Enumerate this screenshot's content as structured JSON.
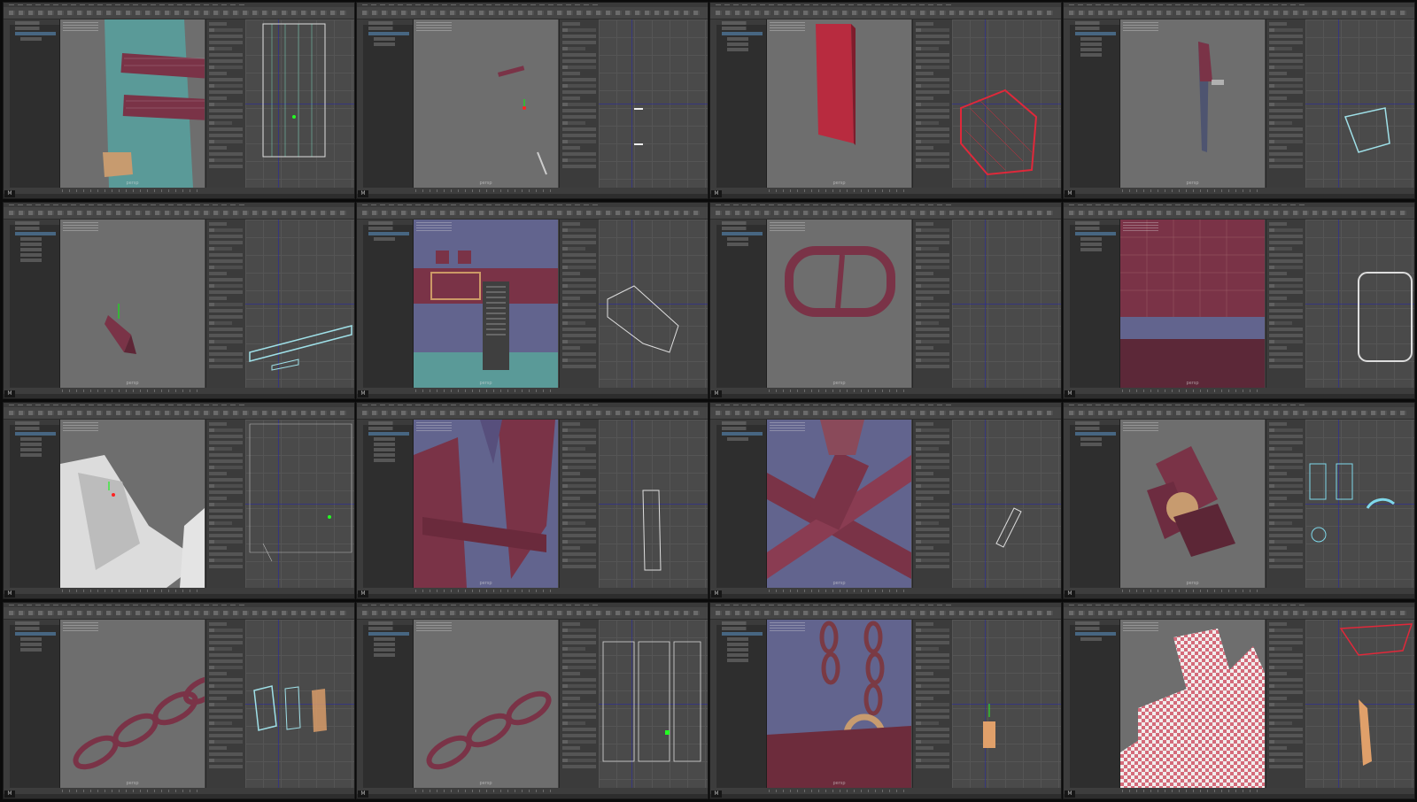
{
  "sheet": {
    "title": "",
    "tile_count": 16
  },
  "tiles": [
    {
      "id": "t1",
      "uv_color": "#d8d8d8",
      "logo": "M",
      "vp": "persp"
    },
    {
      "id": "t2",
      "uv_color": "#e8e8e8",
      "logo": "M",
      "vp": "persp"
    },
    {
      "id": "t3",
      "uv_color": "#e0283a",
      "logo": "M",
      "vp": "persp"
    },
    {
      "id": "t4",
      "uv_color": "#9fe0e8",
      "logo": "M",
      "vp": "persp"
    },
    {
      "id": "t5",
      "uv_color": "#9fe0e8",
      "logo": "M",
      "vp": "persp"
    },
    {
      "id": "t6",
      "uv_color": "#d8d8d8",
      "logo": "M",
      "vp": "persp"
    },
    {
      "id": "t7",
      "uv_color": "#d8d8d8",
      "logo": "M",
      "vp": "persp"
    },
    {
      "id": "t8",
      "uv_color": "#d8d8d8",
      "logo": "M",
      "vp": "persp"
    },
    {
      "id": "t9",
      "uv_color": "#d8d8d8",
      "logo": "M",
      "vp": "persp"
    },
    {
      "id": "t10",
      "uv_color": "#d8d8d8",
      "logo": "M",
      "vp": "persp"
    },
    {
      "id": "t11",
      "uv_color": "#d8d8d8",
      "logo": "M",
      "vp": "persp"
    },
    {
      "id": "t12",
      "uv_color": "#7fd8ea",
      "logo": "M",
      "vp": "persp"
    },
    {
      "id": "t13",
      "uv_color": "#9fe0e8",
      "logo": "M",
      "vp": "persp"
    },
    {
      "id": "t14",
      "uv_color": "#d8d8d8",
      "logo": "M",
      "vp": "persp"
    },
    {
      "id": "t15",
      "uv_color": "#e0a06a",
      "logo": "M",
      "vp": "persp"
    },
    {
      "id": "t16",
      "uv_color": "#e0283a",
      "logo": "M",
      "vp": "persp"
    }
  ],
  "colors": {
    "maroon": "#7a3347",
    "teal": "#5a9a98",
    "purple": "#62648e",
    "skin": "#c79b6f",
    "viewport_bg": "#6e6e6e"
  }
}
